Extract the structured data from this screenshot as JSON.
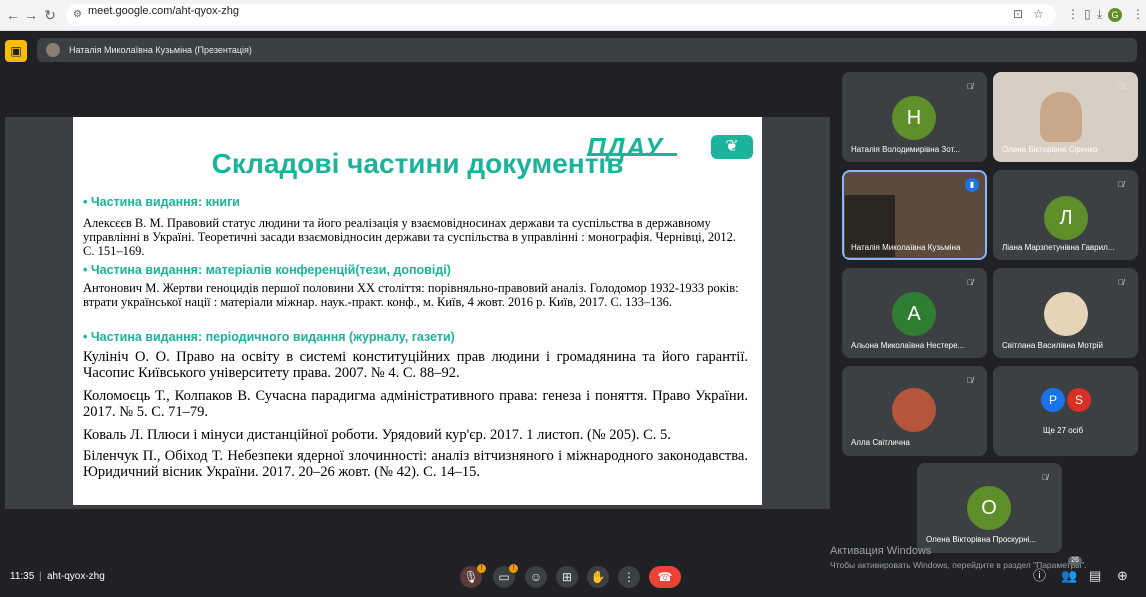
{
  "browser": {
    "url": "meet.google.com/aht-qyox-zhg",
    "icons": [
      "back-icon",
      "forward-icon",
      "reload-icon",
      "site-info-icon",
      "translate-icon",
      "star-icon",
      "extensions-icon",
      "split-icon",
      "download-icon",
      "profile-icon",
      "menu-icon"
    ],
    "profile_initial": "G"
  },
  "meet": {
    "presenter_label": "Наталія Миколаївна Кузьміна (Презентація)",
    "clock": "11:35",
    "separator": "|",
    "meeting_code": "aht-qyox-zhg",
    "people_badge": "26",
    "accent_color": "#1bb39a",
    "end_call_color": "#ea4335"
  },
  "slide": {
    "logo_text": "ПДАУ",
    "title": "Складові частини документів",
    "sections": [
      {
        "heading": "•  Частина видання: книги",
        "refs": [
          "Алексєєв В. М. Правовий статус людини та його реалізація у взаємовідносинах держави та суспільства в державному управлінні в Україні. Теоретичні засади взаємовідносин держави та суспільства в управлінні : монографія. Чернівці, 2012. С. 151–169."
        ]
      },
      {
        "heading": "•  Частина видання: матеріалів конференцій(тези, доповіді)",
        "refs": [
          "Антонович М. Жертви геноцидів першої половини XX століття: порівняльно-правовий аналіз. Голодомор 1932-1933 років: втрати української нації : матеріали міжнар. наук.-практ. конф., м. Київ, 4 жовт. 2016 р. Київ, 2017. С. 133–136."
        ]
      },
      {
        "heading": "•  Частина видання: періодичного видання (журналу, газети)",
        "refs": [
          "Кулініч О. О. Право на освіту в системі конституційних прав людини і громадянина та його гарантії. Часопис Київського університету права. 2007. № 4. С. 88–92.",
          "Коломоєць Т., Колпаков В. Сучасна парадигма адміністративного права: генеза і поняття. Право України. 2017. № 5. С. 71–79.",
          "Коваль Л. Плюси і мінуси дистанційної роботи. Урядовий кур'єр. 2017. 1 листоп. (№ 205). С. 5.",
          "Біленчук П., Обіход Т. Небезпеки ядерної злочинності: аналіз вітчизняного і міжнародного законодавства. Юридичний вісник України. 2017. 20–26 жовт. (№ 42). С. 14–15."
        ]
      }
    ]
  },
  "participants": [
    {
      "name": "Наталія Володимирівна Зот...",
      "initial": "Н",
      "color": "#5f8f2a"
    },
    {
      "name": "Олена Вікторівна Сіренко",
      "initial": "",
      "color": ""
    },
    {
      "name": "Наталія Миколаївна Кузьміна",
      "initial": "",
      "color": ""
    },
    {
      "name": "Ліана Марзпетунівна Гаврил...",
      "initial": "Л",
      "color": "#5f8f2a"
    },
    {
      "name": "Альона Миколаївна Нестере...",
      "initial": "А",
      "color": "#2e7d32"
    },
    {
      "name": "Світлана Василівна Мотрій",
      "initial": "",
      "color": ""
    },
    {
      "name": "Алла Світлична",
      "initial": "",
      "color": ""
    },
    {
      "name": "Ще 27 осіб",
      "initial": "",
      "color": ""
    },
    {
      "name": "Олена Вікторівна Проскурні...",
      "initial": "О",
      "color": "#5f8f2a"
    }
  ],
  "others_avatars": [
    {
      "initial": "P",
      "color": "#1a73e8"
    },
    {
      "initial": "S",
      "color": "#d93025"
    }
  ],
  "windows_watermark": {
    "line1": "Активация Windows",
    "line2": "Чтобы активировать Windows, перейдите в раздел \"Параметры\"."
  },
  "controls": {
    "warning_mark": "!",
    "icons": [
      "mic-off-icon",
      "camera-off-icon",
      "emoji-icon",
      "present-icon",
      "raise-hand-icon",
      "more-options-icon",
      "end-call-icon",
      "info-icon",
      "people-icon",
      "chat-icon",
      "activities-icon"
    ]
  }
}
